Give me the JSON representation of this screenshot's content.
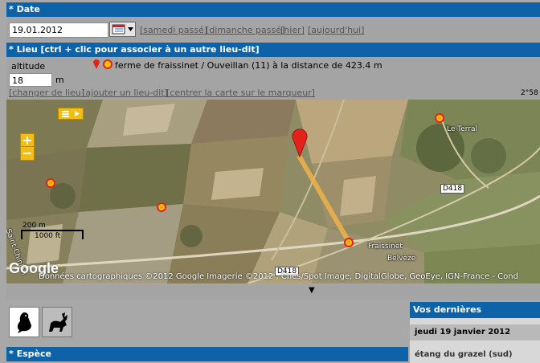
{
  "date_section": {
    "title": "* Date",
    "date_value": "19.01.2012",
    "quick_links": [
      "[samedi passé]",
      "[dimanche passé]",
      "[hier]",
      "[aujourd'hui]"
    ]
  },
  "lieu_section": {
    "title": "* Lieu [ctrl + clic pour associer à un autre lieu-dit]",
    "altitude_label": "altitude",
    "altitude_value": "18",
    "altitude_unit": "m",
    "location_text": "ferme de fraissinet / Ouveillan (11) à la distance de 423.4 m",
    "links": [
      "[changer de lieu]",
      "[ajouter un lieu-dit]",
      "[centrer la carte sur le marqueur]"
    ],
    "edge_text": "2°58"
  },
  "map": {
    "places": [
      "Le Terral",
      "Fraissinet",
      "Belvèze",
      "Saint-Chinian"
    ],
    "roads": [
      "D418",
      "D418"
    ],
    "scale": [
      "200 m",
      "1000 ft"
    ],
    "google_logo": "Google",
    "attribution": "Données cartographiques ©2012 Google Imagerie ©2012 , Cnes/Spot Image, DigitalGlobe, GeoEye, IGN-France - Cond",
    "expand_arrow": "▼",
    "zoom_in": "+",
    "zoom_out": "−"
  },
  "observations": {
    "title": "Vos dernières observations",
    "date": "jeudi 19 janvier 2012",
    "entry": "étang du grazel (sud)"
  },
  "espece_section": {
    "title": "* Espèce"
  },
  "colors": {
    "header_blue": "#0e63a8",
    "panel_grey": "#a4a4a4",
    "marker_red": "#e2221b",
    "marker_yellow": "#f7c20c"
  }
}
